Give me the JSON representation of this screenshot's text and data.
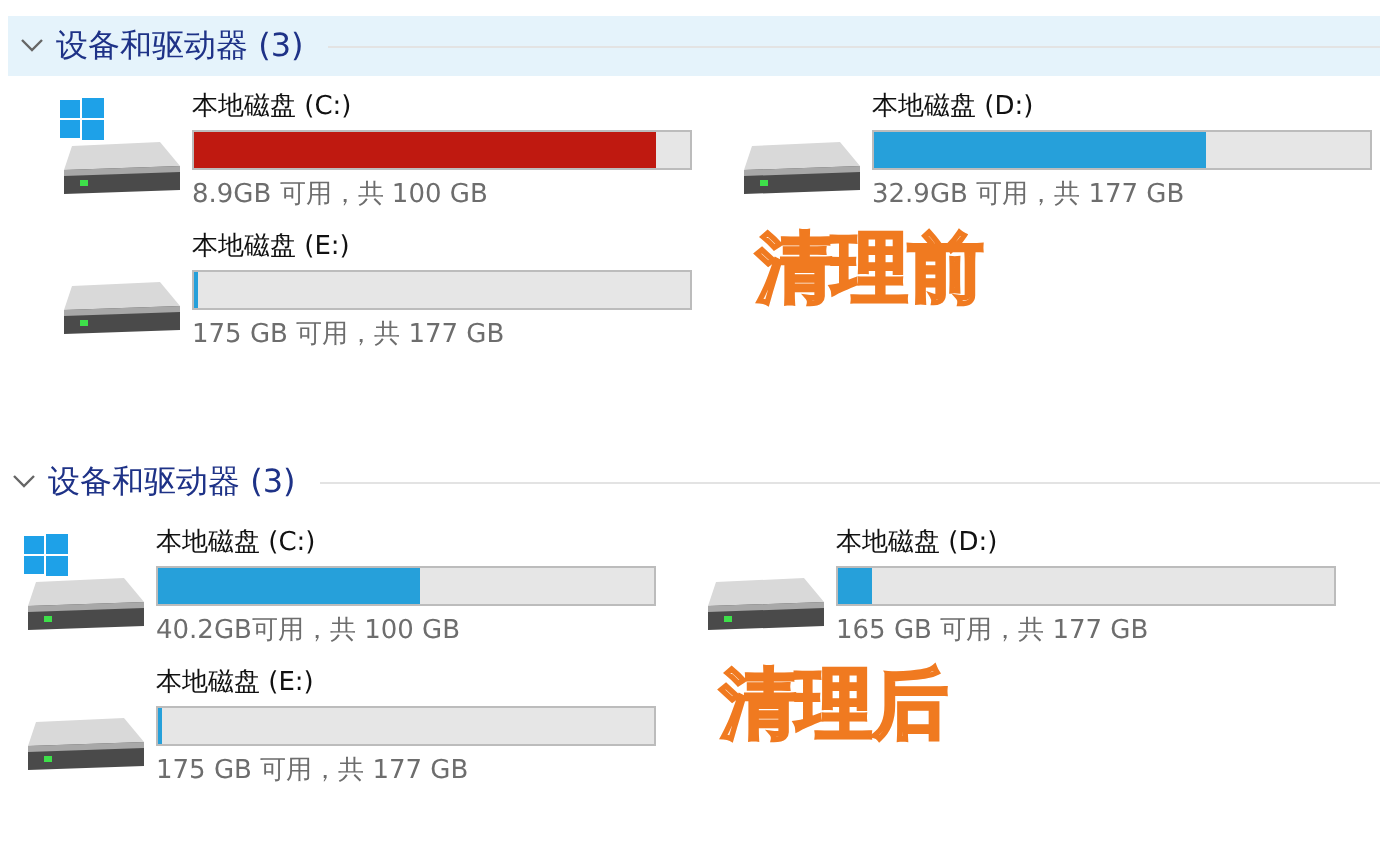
{
  "sections": [
    {
      "title": "设备和驱动器 (3)",
      "highlighted": true,
      "expanded": true,
      "note": "清理前",
      "drives": [
        {
          "name": "本地磁盘 (C:)",
          "system": true,
          "warning": true,
          "level": 0.93,
          "info": "8.9GB 可用，共 100 GB"
        },
        {
          "name": "本地磁盘 (D:)",
          "system": false,
          "warning": false,
          "level": 0.67,
          "info": "32.9GB 可用，共 177 GB"
        },
        {
          "name": "本地磁盘 (E:)",
          "system": false,
          "warning": false,
          "level": 0.01,
          "info": "175 GB 可用，共 177 GB"
        }
      ]
    },
    {
      "title": "设备和驱动器 (3)",
      "highlighted": false,
      "expanded": true,
      "note": "清理后",
      "drives": [
        {
          "name": "本地磁盘 (C:)",
          "system": true,
          "warning": false,
          "level": 0.53,
          "info": "40.2GB可用，共 100 GB"
        },
        {
          "name": "本地磁盘 (D:)",
          "system": false,
          "warning": false,
          "level": 0.07,
          "info": "165 GB 可用，共 177 GB"
        },
        {
          "name": "本地磁盘 (E:)",
          "system": false,
          "warning": false,
          "level": 0.01,
          "info": "175 GB 可用，共 177 GB"
        }
      ]
    }
  ]
}
